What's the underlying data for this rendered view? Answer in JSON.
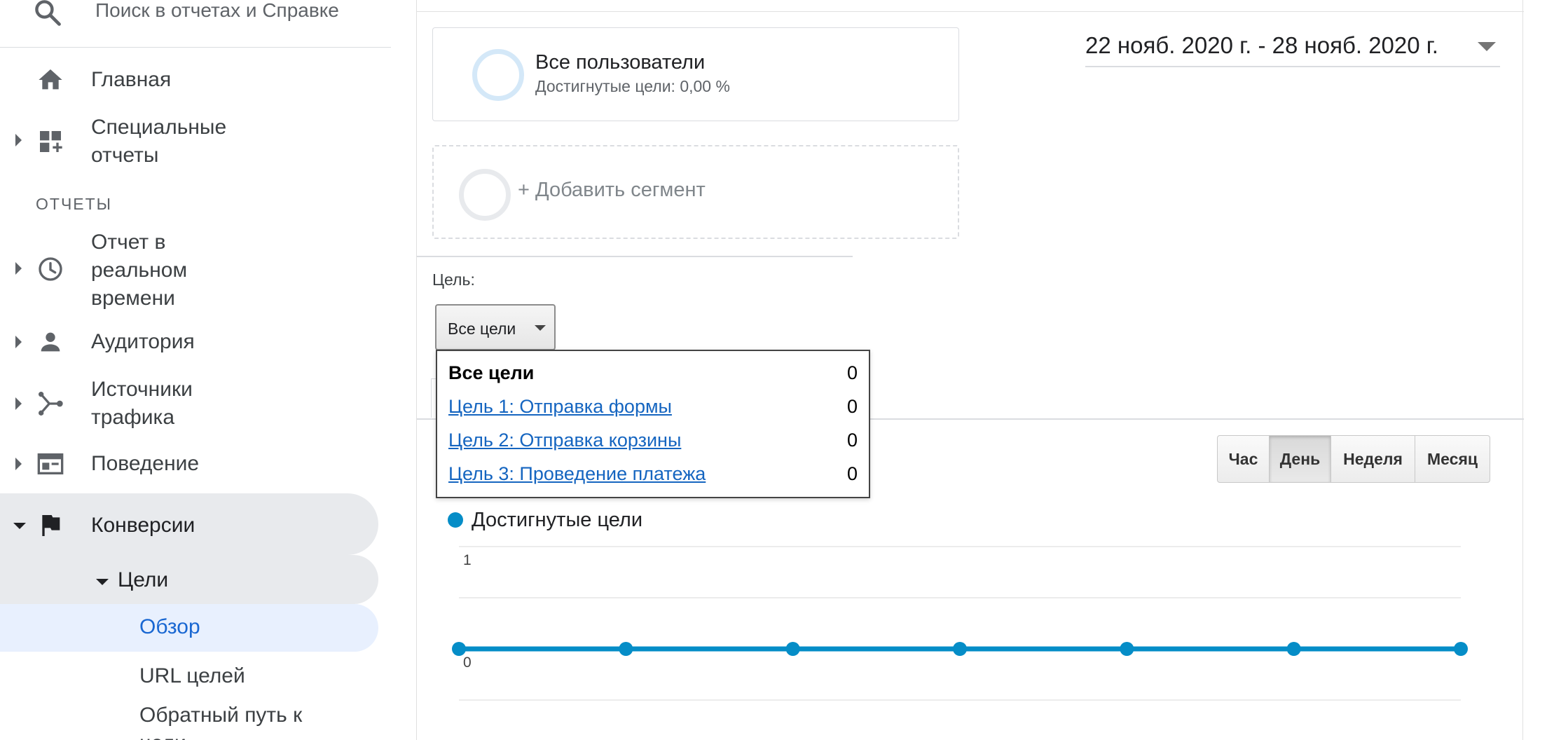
{
  "search": {
    "placeholder": "Поиск в отчетах и Справке"
  },
  "sidebar": {
    "home_label": "Главная",
    "custom_reports_label_1": "Специальные",
    "custom_reports_label_2": "отчеты",
    "section_label": "ОТЧЕТЫ",
    "realtime_label_1": "Отчет в",
    "realtime_label_2": "реальном",
    "realtime_label_3": "времени",
    "audience_label": "Аудитория",
    "acquisition_label_1": "Источники",
    "acquisition_label_2": "трафика",
    "behavior_label": "Поведение",
    "conversions_label": "Конверсии",
    "goals_label": "Цели",
    "overview_label": "Обзор",
    "goal_urls_label": "URL целей",
    "reverse_path_label": "Обратный путь к",
    "reverse_path_label_2": "цели"
  },
  "segments": {
    "all_users_title": "Все пользователи",
    "all_users_sub": "Достигнутые цели: 0,00 %",
    "add_segment_label": "+ Добавить сегмент"
  },
  "date_range": {
    "text": "22 нояб. 2020 г. - 28 нояб. 2020 г."
  },
  "goal_selector": {
    "label": "Цель:",
    "selected": "Все цели",
    "options": [
      {
        "label": "Все цели",
        "value": "0"
      },
      {
        "label": "Цель 1: Отправка формы",
        "value": "0"
      },
      {
        "label": "Цель 2: Отправка корзины",
        "value": "0"
      },
      {
        "label": "Цель 3: Проведение платежа",
        "value": "0"
      }
    ]
  },
  "period_buttons": [
    "Час",
    "День",
    "Неделя",
    "Месяц"
  ],
  "period_active": "День",
  "legend": {
    "series_name": "Достигнутые цели",
    "color": "#058dc7"
  },
  "colors": {
    "series": "#058dc7",
    "active_nav": "#1967d2",
    "highlight": "#e8eaed",
    "active_bg": "#e8f0fe"
  },
  "chart_data": {
    "type": "line",
    "series": [
      {
        "name": "Достигнутые цели",
        "values": [
          0,
          0,
          0,
          0,
          0,
          0,
          0
        ]
      }
    ],
    "yticks": [
      "1",
      "0"
    ],
    "ylim": [
      0,
      1
    ]
  }
}
